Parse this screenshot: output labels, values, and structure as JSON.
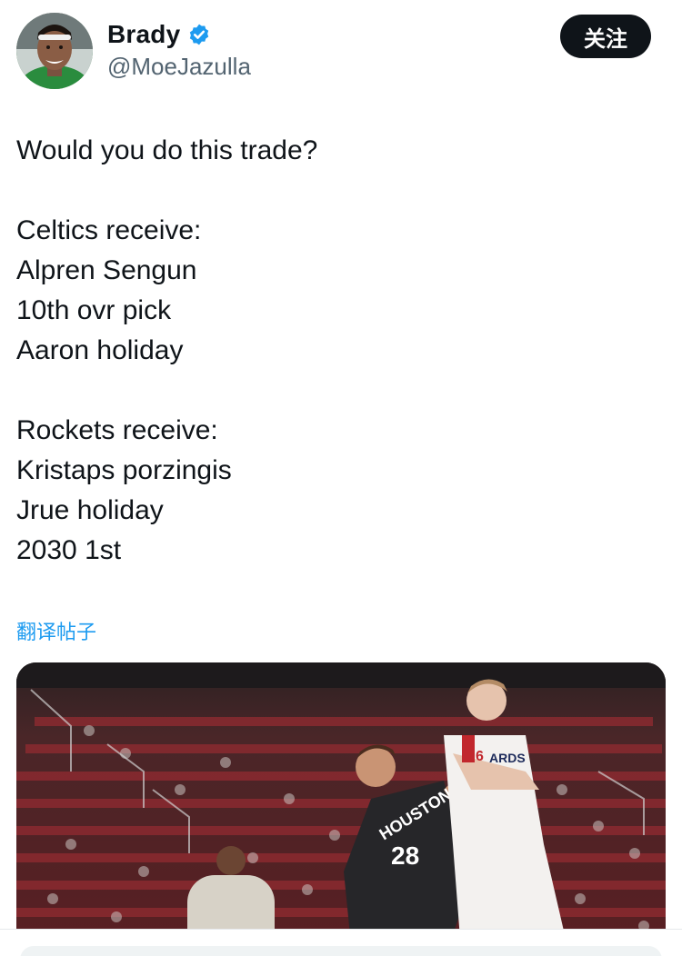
{
  "header": {
    "display_name": "Brady",
    "handle": "@MoeJazulla",
    "follow_label": "关注",
    "verified": true,
    "verified_color": "#1d9bf0"
  },
  "tweet": {
    "lines": [
      "Would you do this trade?",
      "",
      "Celtics receive:",
      "Alpren Sengun",
      "10th ovr pick",
      "Aaron holiday",
      "",
      "Rockets receive:",
      "Kristaps porzingis",
      "Jrue holiday",
      "2030 1st"
    ]
  },
  "translate_label": "翻译帖子",
  "media": {
    "jersey_text": "HOUSTON",
    "jersey_number": "28",
    "opponent_jersey_text": "ARDS",
    "opponent_number": "6"
  }
}
